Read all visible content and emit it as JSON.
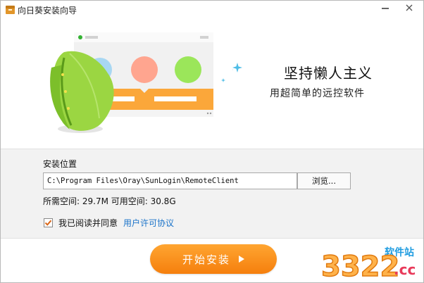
{
  "window": {
    "title": "向日葵安装向导"
  },
  "hero": {
    "slogan_title": "坚持懒人主义",
    "slogan_subtitle": "用超简单的远控软件"
  },
  "install": {
    "location_label": "安装位置",
    "path_value": "C:\\Program Files\\Oray\\SunLogin\\RemoteClient",
    "browse_label": "浏览...",
    "space_text": "所需空间: 29.7M 可用空间: 30.8G",
    "agree_text": "我已阅读并同意",
    "agree_checked": true,
    "license_link": "用户许可协议"
  },
  "footer": {
    "start_label": "开始安装",
    "watermark_brand": "软件站",
    "watermark_number": "3322",
    "watermark_domain": ".cc"
  },
  "colors": {
    "accent_orange": "#f88b1c",
    "link_blue": "#1a73c9",
    "leaf_green": "#8fd43a"
  }
}
